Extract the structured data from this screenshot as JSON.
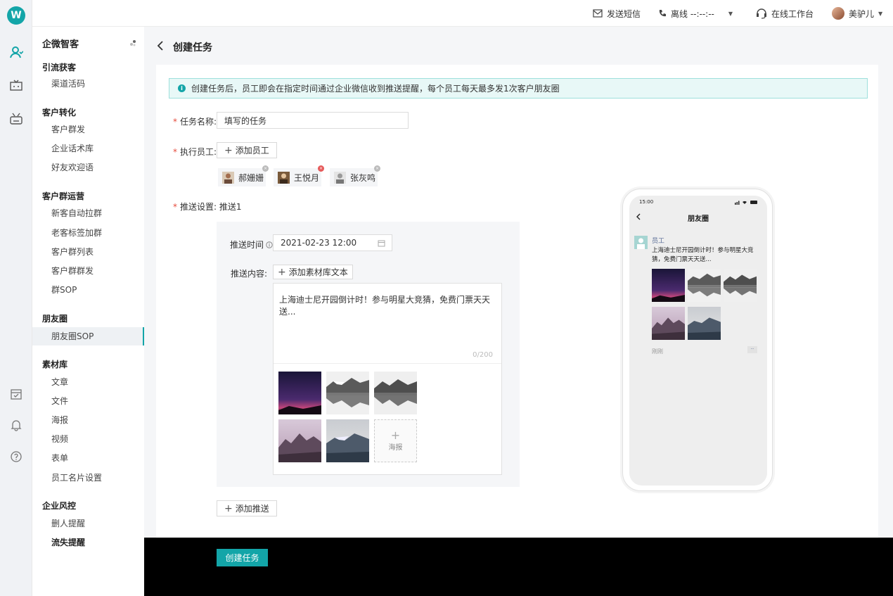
{
  "brand": {
    "logo_glyph": "W",
    "accent": "#13a5a8"
  },
  "topbar": {
    "sms_label": "发送短信",
    "status_label": "离线 --:--:--",
    "workbench_label": "在线工作台",
    "user_name": "美驴儿"
  },
  "menu": {
    "title": "企微智客",
    "groups": [
      {
        "title": "引流获客",
        "items": [
          "渠道活码"
        ]
      },
      {
        "title": "客户转化",
        "items": [
          "客户群发",
          "企业话术库",
          "好友欢迎语"
        ]
      },
      {
        "title": "客户群运营",
        "items": [
          "新客自动拉群",
          "老客标签加群",
          "客户群列表",
          "客户群群发",
          "群SOP"
        ]
      },
      {
        "title": "朋友圈",
        "items": [
          "朋友圈SOP"
        ]
      },
      {
        "title": "素材库",
        "items": [
          "文章",
          "文件",
          "海报",
          "视频",
          "表单",
          "员工名片设置"
        ]
      },
      {
        "title": "企业风控",
        "items": [
          "删人提醒",
          "流失提醒"
        ]
      }
    ],
    "active_item": "朋友圈SOP"
  },
  "page": {
    "title": "创建任务",
    "notice": "创建任务后，员工即会在指定时间通过企业微信收到推送提醒，每个员工每天最多发1次客户朋友圈"
  },
  "form": {
    "task_name_label": "任务名称:",
    "task_name_value": "填写的任务",
    "staff_label": "执行员工:",
    "add_staff_label": "添加员工",
    "staff": [
      "郝姗姗",
      "王悦月",
      "张灰鸣"
    ],
    "push_label": "推送设置:",
    "push_name": "推送1",
    "push_time_label": "推送时间",
    "push_time_value": "2021-02-23 12:00",
    "push_content_label": "推送内容:",
    "add_material_label": "添加素材库文本",
    "content_text": "上海迪士尼开园倒计时！参与明星大竞猜，免费门票天天送...",
    "char_count": "0/200",
    "add_poster_label": "海报",
    "add_push_label": "添加推送",
    "submit_label": "创建任务"
  },
  "preview": {
    "time": "15:00",
    "nav_title": "朋友圈",
    "author": "员工",
    "text": "上海迪士尼开园倒计时！参与明星大竞猜，免费门票天天送...",
    "time_ago": "刚刚",
    "more": "··"
  }
}
